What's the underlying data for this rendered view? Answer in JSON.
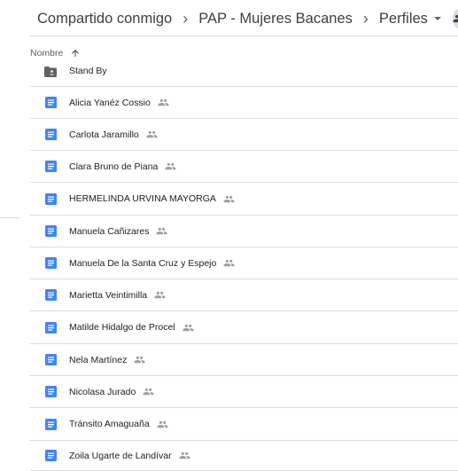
{
  "breadcrumb": {
    "root": "Compartido conmigo",
    "folder": "PAP - Mujeres Bacanes",
    "current": "Perfiles"
  },
  "columns": {
    "name_header": "Nombre"
  },
  "files": [
    {
      "name": "Stand By",
      "type": "shared-folder",
      "shared": false
    },
    {
      "name": "Alicia Yanéz Cossio",
      "type": "doc",
      "shared": true
    },
    {
      "name": "Carlota Jaramillo",
      "type": "doc",
      "shared": true
    },
    {
      "name": "Clara Bruno de Piana",
      "type": "doc",
      "shared": true
    },
    {
      "name": "HERMELINDA URVINA MAYORGA",
      "type": "doc",
      "shared": true
    },
    {
      "name": "Manuela Cañizares",
      "type": "doc",
      "shared": true
    },
    {
      "name": "Manuela De la Santa Cruz y Espejo",
      "type": "doc",
      "shared": true
    },
    {
      "name": "Marietta Veintimilla",
      "type": "doc",
      "shared": true
    },
    {
      "name": "Matilde Hidalgo de Procel",
      "type": "doc",
      "shared": true
    },
    {
      "name": "Nela Martínez",
      "type": "doc",
      "shared": true
    },
    {
      "name": "Nicolasa Jurado",
      "type": "doc",
      "shared": true
    },
    {
      "name": "Tránsito Amaguaña",
      "type": "doc",
      "shared": true
    },
    {
      "name": "Zoila Ugarte de Landívar",
      "type": "doc",
      "shared": true
    }
  ],
  "colors": {
    "doc_icon": "#4285f4",
    "folder_icon": "#5f6368",
    "shared_icon": "#9aa0a6",
    "divider": "#dadce0"
  }
}
